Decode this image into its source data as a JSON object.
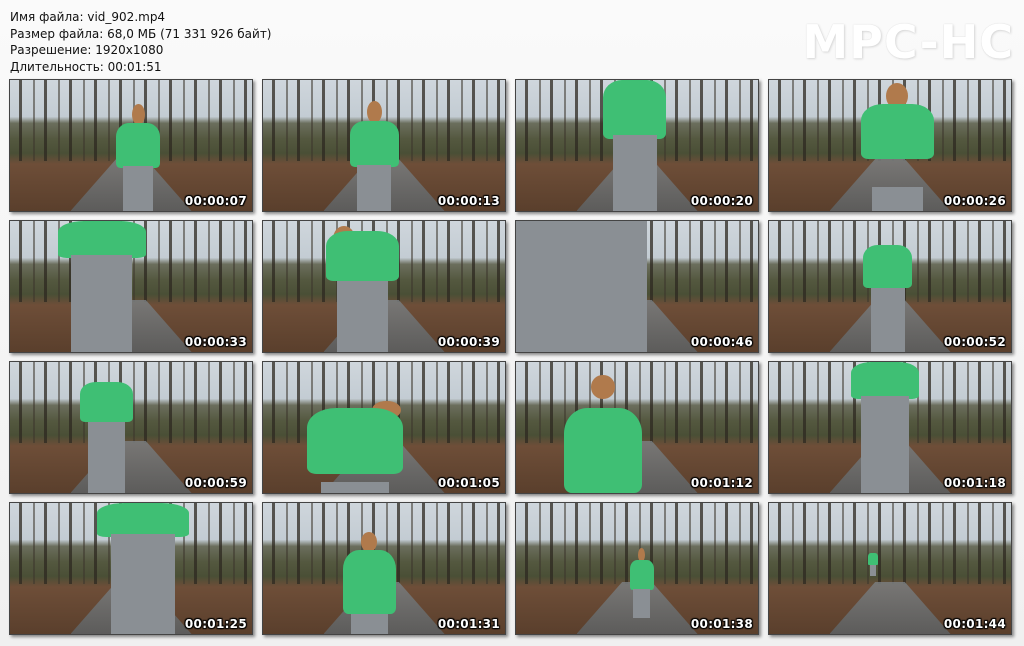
{
  "file_info": {
    "name_line": "Имя файла: vid_902.mp4",
    "size_line": "Размер файла: 68,0 МБ (71 331 926 байт)",
    "resolution_line": "Разрешение: 1920x1080",
    "duration_line": "Длительность: 00:01:51"
  },
  "logo": "MPC-HC",
  "thumbnails": [
    {
      "time": "00:00:07"
    },
    {
      "time": "00:00:13"
    },
    {
      "time": "00:00:20"
    },
    {
      "time": "00:00:26"
    },
    {
      "time": "00:00:33"
    },
    {
      "time": "00:00:39"
    },
    {
      "time": "00:00:46"
    },
    {
      "time": "00:00:52"
    },
    {
      "time": "00:00:59"
    },
    {
      "time": "00:01:05"
    },
    {
      "time": "00:01:12"
    },
    {
      "time": "00:01:18"
    },
    {
      "time": "00:01:25"
    },
    {
      "time": "00:01:31"
    },
    {
      "time": "00:01:38"
    },
    {
      "time": "00:01:44"
    }
  ],
  "colors": {
    "jacket": "#3fbf74",
    "timestamp": "#ffffff",
    "logo": "#ffffff"
  }
}
